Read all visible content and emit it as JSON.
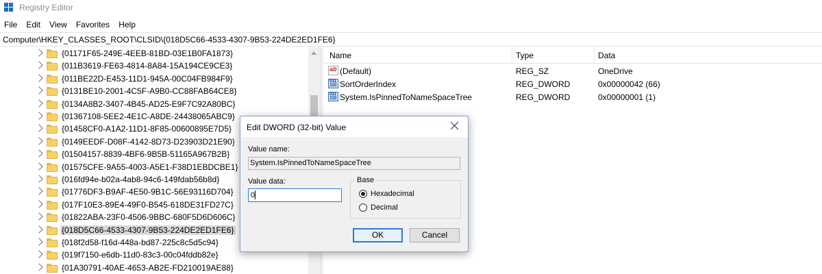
{
  "window": {
    "title": "Registry Editor"
  },
  "menu": [
    "File",
    "Edit",
    "View",
    "Favorites",
    "Help"
  ],
  "address": "Computer\\HKEY_CLASSES_ROOT\\CLSID\\{018D5C66-4533-4307-9B53-224DE2ED1FE6}",
  "tree": {
    "items": [
      "{01171F65-249E-4EEB-81BD-03E1B0FA1873}",
      "{011B3619-FE63-4814-8A84-15A194CE9CE3}",
      "{011BE22D-E453-11D1-945A-00C04FB984F9}",
      "{0131BE10-2001-4C5F-A9B0-CC88FAB64CE8}",
      "{0134A8B2-3407-4B45-AD25-E9F7C92A80BC}",
      "{01367108-5EE2-4E1C-A8DE-24438065ABC9}",
      "{01458CF0-A1A2-11D1-8F85-00600895E7D5}",
      "{0149EEDF-D08F-4142-8D73-D23903D21E90}",
      "{01504157-8839-4BF6-9B5B-51165A967B2B}",
      "{01575CFE-9A55-4003-A5E1-F38D1EBDCBE1}",
      "{016fd94e-b02a-4ab8-94c6-149fdab56b8d}",
      "{01776DF3-B9AF-4E50-9B1C-56E93116D704}",
      "{017F10E3-89E4-49F0-B545-618DE31FD27C}",
      "{01822ABA-23F0-4506-9BBC-680F5D6D606C}",
      "{018D5C66-4533-4307-9B53-224DE2ED1FE6}",
      "{018f2d58-f16d-448a-bd87-225c8c5d5c94}",
      "{019f7150-e6db-11d0-83c3-00c04fddb82e}",
      "{01A30791-40AE-4653-AB2E-FD210019AE88}"
    ],
    "selected_index": 14
  },
  "list": {
    "headers": {
      "name": "Name",
      "type": "Type",
      "data": "Data"
    },
    "rows": [
      {
        "name": "(Default)",
        "type": "REG_SZ",
        "data": "OneDrive",
        "icon": "string-value-icon"
      },
      {
        "name": "SortOrderIndex",
        "type": "REG_DWORD",
        "data": "0x00000042 (66)",
        "icon": "dword-value-icon"
      },
      {
        "name": "System.IsPinnedToNameSpaceTree",
        "type": "REG_DWORD",
        "data": "0x00000001 (1)",
        "icon": "dword-value-icon"
      }
    ]
  },
  "dialog": {
    "title": "Edit DWORD (32-bit) Value",
    "value_name_label": "Value name:",
    "value_name": "System.IsPinnedToNameSpaceTree",
    "value_data_label": "Value data:",
    "value_data": "0",
    "base_label": "Base",
    "hex_label": "Hexadecimal",
    "dec_label": "Decimal",
    "base_selected": "Hexadecimal",
    "ok_label": "OK",
    "cancel_label": "Cancel"
  },
  "colors": {
    "folder": "#f6d266",
    "selection": "#d9d9d9",
    "focus": "#2b79d6"
  }
}
